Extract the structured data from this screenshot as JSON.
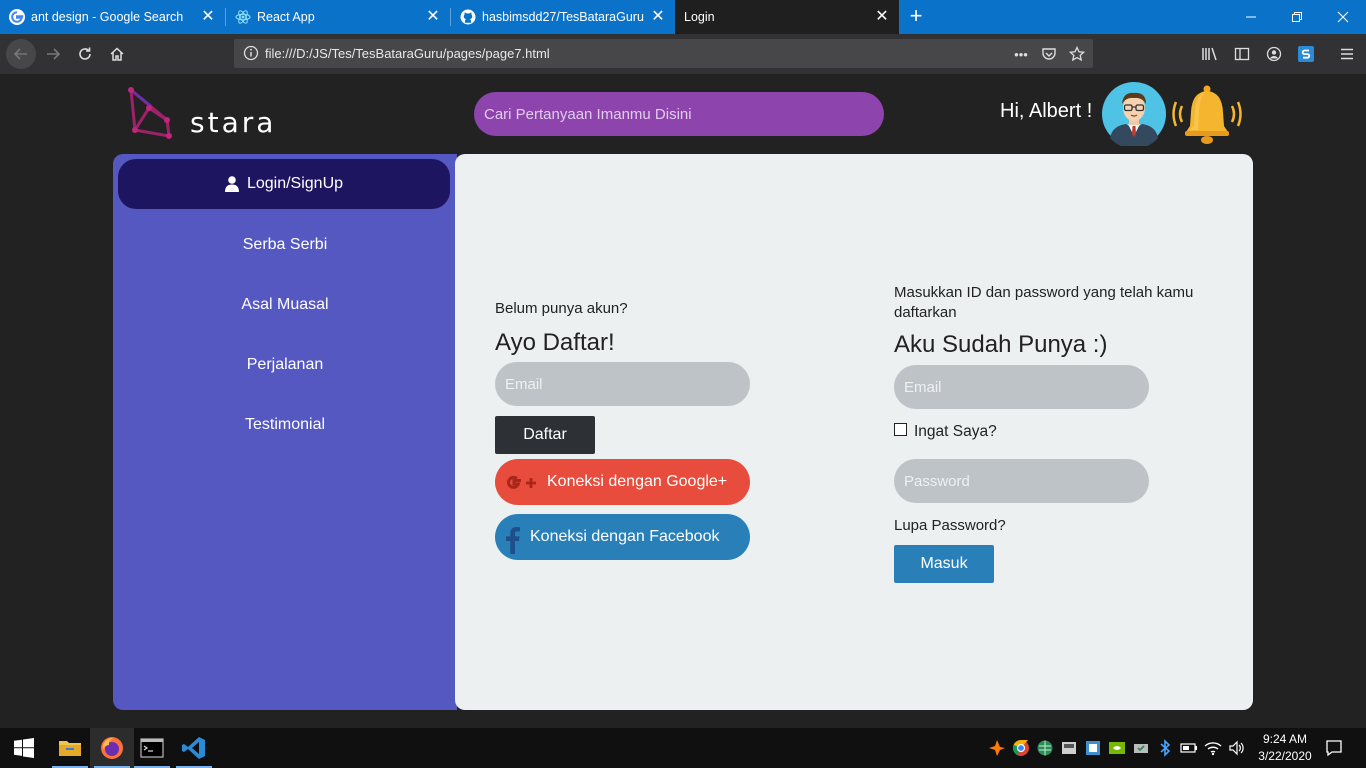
{
  "browser": {
    "tabs": [
      {
        "title": "ant design - Google Search",
        "close": "✕"
      },
      {
        "title": "React App",
        "close": "✕"
      },
      {
        "title": "hasbimsdd27/TesBataraGuru",
        "close": "✕"
      },
      {
        "title": "Login",
        "close": "✕"
      }
    ],
    "new_tab": "+",
    "url": "file:///D:/JS/Tes/TesBataraGuru/pages/page7.html",
    "page_actions_label": "•••"
  },
  "header": {
    "logo_text": "stara",
    "search_placeholder": "Cari Pertanyaan Imanmu Disini",
    "greeting": "Hi, Albert !"
  },
  "sidebar": {
    "login_label": "Login/SignUp",
    "items": [
      {
        "label": "Serba Serbi"
      },
      {
        "label": "Asal Muasal"
      },
      {
        "label": "Perjalanan"
      },
      {
        "label": "Testimonial"
      }
    ]
  },
  "register": {
    "prompt": "Belum punya akun?",
    "heading": "Ayo Daftar!",
    "email_placeholder": "Email",
    "daftar_label": "Daftar",
    "google_label": "Koneksi dengan Google+",
    "facebook_label": "Koneksi dengan Facebook"
  },
  "login": {
    "prompt": "Masukkan ID dan password yang telah kamu daftarkan",
    "heading": "Aku Sudah Punya :)",
    "email_placeholder": "Email",
    "remember_label": "Ingat Saya?",
    "password_placeholder": "Password",
    "forgot_label": "Lupa Password?",
    "masuk_label": "Masuk"
  },
  "taskbar": {
    "time": "9:24 AM",
    "date": "3/22/2020"
  },
  "colors": {
    "tab_bar": "#0a72c9",
    "sidebar": "#5558c0",
    "sidebar_active": "#1e1561",
    "search": "#8e44ad",
    "content_bg": "#ecf0f1",
    "google": "#e74c3c",
    "facebook": "#2980b9",
    "dark_button": "#2d3136"
  }
}
